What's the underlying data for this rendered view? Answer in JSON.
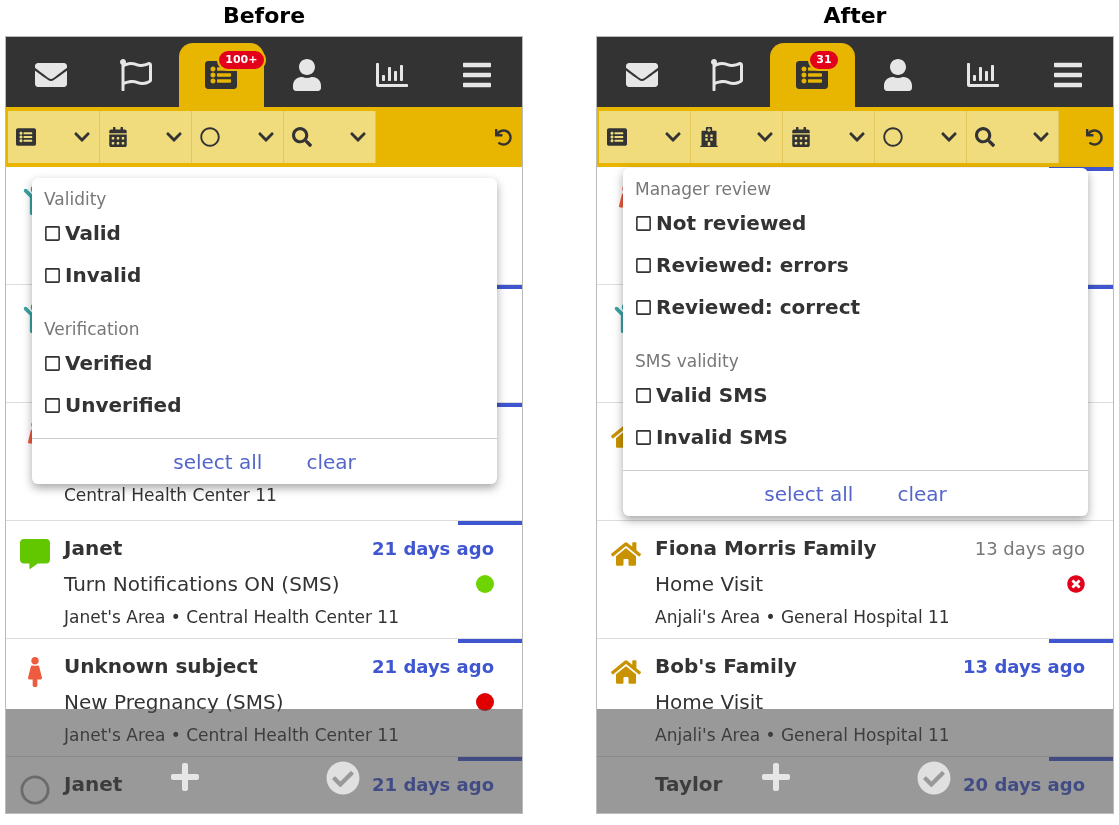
{
  "panels": [
    {
      "title": "Before",
      "tabs": [
        {
          "kind": "messages",
          "selected": false
        },
        {
          "kind": "tasks",
          "selected": false
        },
        {
          "kind": "reports",
          "selected": true,
          "badge": "100+"
        },
        {
          "kind": "contacts",
          "selected": false
        },
        {
          "kind": "analytics",
          "selected": false
        },
        {
          "kind": "menu",
          "selected": false
        }
      ],
      "filters": [
        {
          "kind": "forms"
        },
        {
          "kind": "date"
        },
        {
          "kind": "status"
        },
        {
          "kind": "search"
        }
      ],
      "rows": [
        {
          "kind": "child",
          "unread": false
        },
        {
          "kind": "child",
          "unread": true
        },
        {
          "kind": "woman",
          "unread": true,
          "meta": "Central Health Center 11"
        },
        {
          "kind": "message",
          "unread": true,
          "name": "Janet",
          "time": "21 days ago",
          "form": "Turn Notifications ON (SMS)",
          "status": {
            "kind": "dot",
            "color": "#6dd400"
          },
          "meta": "Janet's Area • Central Health Center 11"
        },
        {
          "kind": "woman",
          "unread": true,
          "name": "Unknown subject",
          "time": "21 days ago",
          "form": "New Pregnancy (SMS)",
          "status": {
            "kind": "dot",
            "color": "#e00000"
          },
          "meta": "Janet's Area • Central Health Center 11"
        },
        {
          "kind": "circle",
          "unread": true,
          "name": "Janet",
          "time": "21 days ago"
        }
      ],
      "dropdown": {
        "sections": [
          {
            "heading": "Validity",
            "options": [
              {
                "label": "Valid",
                "checked": false
              },
              {
                "label": "Invalid",
                "checked": false
              }
            ]
          },
          {
            "heading": "Verification",
            "options": [
              {
                "label": "Verified",
                "checked": false
              },
              {
                "label": "Unverified",
                "checked": false
              }
            ]
          }
        ],
        "actions": [
          "select all",
          "clear"
        ]
      }
    },
    {
      "title": "After",
      "tabs": [
        {
          "kind": "messages",
          "selected": false
        },
        {
          "kind": "tasks",
          "selected": false
        },
        {
          "kind": "reports",
          "selected": true,
          "badge": "31"
        },
        {
          "kind": "contacts",
          "selected": false
        },
        {
          "kind": "analytics",
          "selected": false
        },
        {
          "kind": "menu",
          "selected": false
        }
      ],
      "filters": [
        {
          "kind": "forms"
        },
        {
          "kind": "facility"
        },
        {
          "kind": "date"
        },
        {
          "kind": "status"
        },
        {
          "kind": "search"
        }
      ],
      "rows": [
        {
          "kind": "woman",
          "unread": true
        },
        {
          "kind": "child",
          "unread": true
        },
        {
          "kind": "home",
          "unread": false
        },
        {
          "kind": "home",
          "unread": false,
          "name": "Fiona Morris Family",
          "time": "13 days ago",
          "form": "Home Visit",
          "status": {
            "kind": "error"
          },
          "meta": "Anjali's Area • General Hospital 11"
        },
        {
          "kind": "home",
          "unread": true,
          "name": "Bob's Family",
          "time": "13 days ago",
          "form": "Home Visit",
          "meta": "Anjali's Area • General Hospital 11"
        },
        {
          "kind": "none",
          "unread": true,
          "name": "Taylor",
          "time": "20 days ago"
        }
      ],
      "dropdown": {
        "sections": [
          {
            "heading": "Manager review",
            "options": [
              {
                "label": "Not reviewed",
                "checked": false
              },
              {
                "label": "Reviewed: errors",
                "checked": false
              },
              {
                "label": "Reviewed: correct",
                "checked": false
              }
            ]
          },
          {
            "heading": "SMS validity",
            "options": [
              {
                "label": "Valid SMS",
                "checked": false
              },
              {
                "label": "Invalid SMS",
                "checked": false
              }
            ]
          }
        ],
        "actions": [
          "select all",
          "clear"
        ]
      }
    }
  ]
}
